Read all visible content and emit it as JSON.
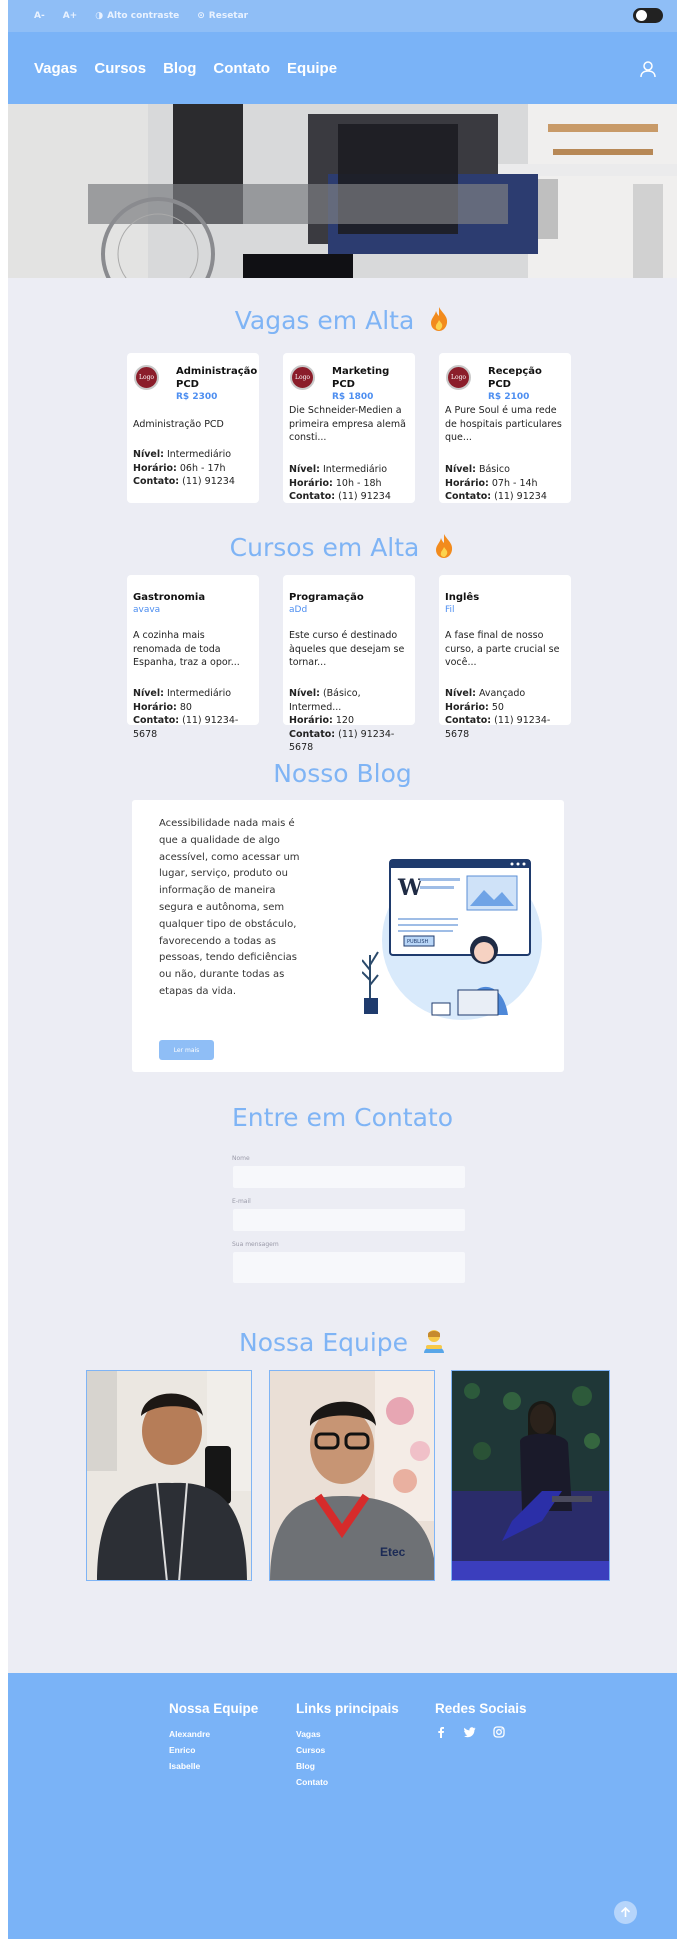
{
  "accessibility_bar": {
    "decrease_font": "A-",
    "increase_font": "A+",
    "high_contrast": "Alto contraste",
    "reset": "Resetar"
  },
  "nav": {
    "links": [
      "Vagas",
      "Cursos",
      "Blog",
      "Contato",
      "Equipe"
    ]
  },
  "jobs": {
    "title": "Vagas em Alta",
    "items": [
      {
        "logo": "Logo",
        "title": "Administração PCD",
        "salary": "R$ 2300",
        "desc": "Administração PCD",
        "nivel": "Intermediário",
        "horario": "06h - 17h",
        "contato": "(11) 91234"
      },
      {
        "logo": "Logo",
        "title": "Marketing PCD",
        "salary": "R$ 1800",
        "desc": "Die Schneider-Medien a primeira empresa alemã consti...",
        "nivel": "Intermediário",
        "horario": "10h - 18h",
        "contato": "(11) 91234"
      },
      {
        "logo": "Logo",
        "title": "Recepção PCD",
        "salary": "R$ 2100",
        "desc": "A Pure Soul é uma rede de hospitais particulares que...",
        "nivel": "Básico",
        "horario": "07h - 14h",
        "contato": "(11) 91234"
      }
    ]
  },
  "courses": {
    "title": "Cursos em Alta",
    "items": [
      {
        "title": "Gastronomia",
        "sub": "avava",
        "desc": "A cozinha mais renomada de toda Espanha, traz a opor...",
        "nivel": "Intermediário",
        "horario": "80",
        "contato": "(11) 91234-5678"
      },
      {
        "title": "Programação",
        "sub": "aDd",
        "desc": "Este curso é destinado àqueles que desejam se tornar...",
        "nivel": "(Básico, Intermed...",
        "horario": "120",
        "contato": "(11) 91234-5678"
      },
      {
        "title": "Inglês",
        "sub": "Fil",
        "desc": "A fase final de nosso curso, a parte crucial se você...",
        "nivel": "Avançado",
        "horario": "50",
        "contato": "(11) 91234-5678"
      }
    ]
  },
  "labels": {
    "nivel": "Nível:",
    "horario": "Horário:",
    "contato": "Contato:"
  },
  "blog": {
    "title": "Nosso Blog",
    "text": "Acessibilidade nada mais é que a qualidade de algo acessível, como acessar um lugar, serviço, produto ou informação de maneira segura e autônoma, sem qualquer tipo de obstáculo, favorecendo a todas as pessoas, tendo deficiências ou não, durante todas as etapas da vida.",
    "button": "Ler mais",
    "publish_label": "PUBLISH"
  },
  "contact": {
    "title": "Entre em Contato",
    "name_label": "Nome",
    "email_label": "E-mail",
    "message_label": "Sua mensagem"
  },
  "team": {
    "title": "Nossa Equipe",
    "photo_text": "Etec"
  },
  "footer": {
    "team_heading": "Nossa Equipe",
    "team_members": [
      "Alexandre",
      "Enrico",
      "Isabelle"
    ],
    "links_heading": "Links principais",
    "links": [
      "Vagas",
      "Cursos",
      "Blog",
      "Contato"
    ],
    "social_heading": "Redes Sociais",
    "social_icons": [
      "facebook-icon",
      "twitter-icon",
      "instagram-icon"
    ]
  },
  "colors": {
    "accent": "#7ab3f7",
    "title": "#7fb4f5",
    "link": "#4d8ef0"
  }
}
